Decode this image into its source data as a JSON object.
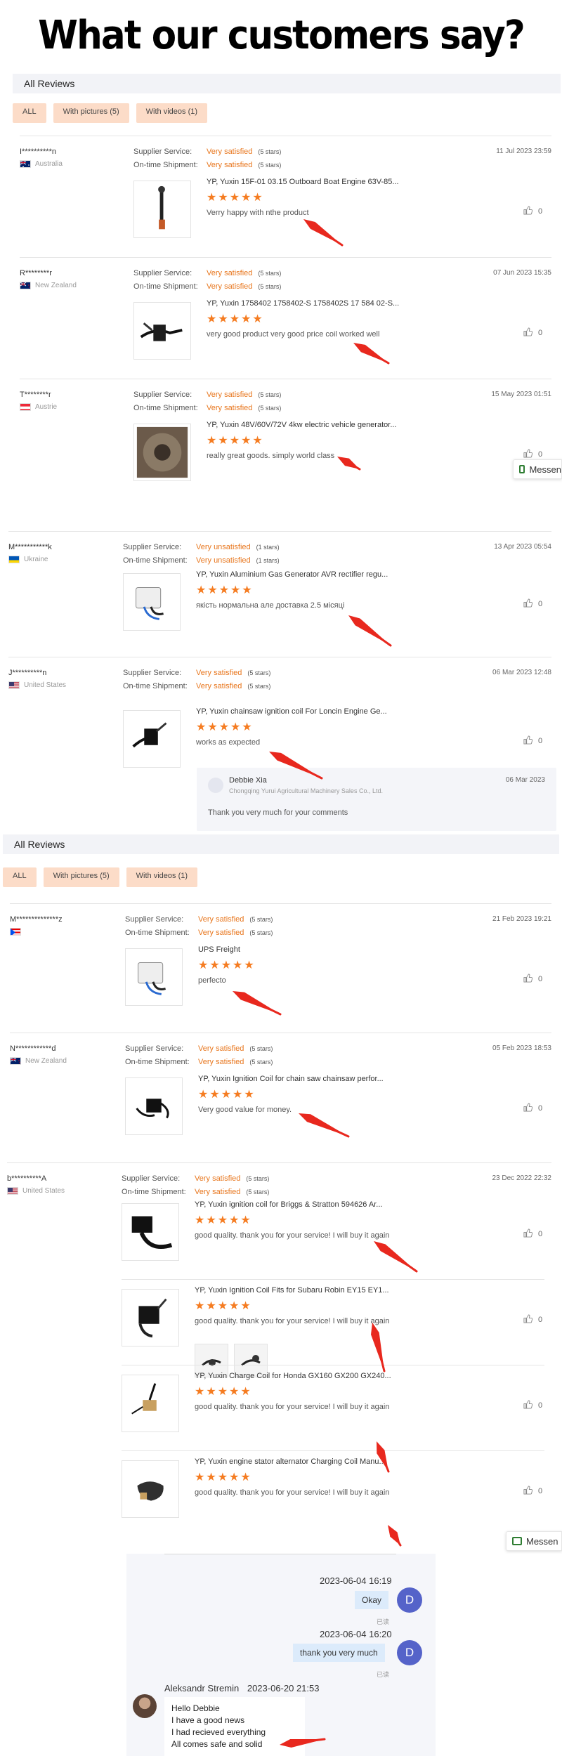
{
  "headline": "What our customers say?",
  "section1": {
    "title": "All Reviews",
    "filters": [
      "ALL",
      "With pictures (5)",
      "With videos (1)"
    ]
  },
  "section2": {
    "title": "All Reviews",
    "filters": [
      "ALL",
      "With pictures (5)",
      "With videos (1)"
    ]
  },
  "labels": {
    "supplier": "Supplier Service:",
    "shipment": "On-time Shipment:"
  },
  "colors": {
    "accent": "#e8761d",
    "star": "#f57c21",
    "filter_bg": "#fcdcc8",
    "arrow": "#e8281e"
  },
  "reviews": [
    {
      "user": "I**********n",
      "country": "Australia",
      "flag": "au",
      "date": "11 Jul 2023 23:59",
      "supplier": "Very satisfied",
      "supplier_count": "(5 stars)",
      "shipment": "Very satisfied",
      "shipment_count": "(5 stars)",
      "products": [
        {
          "title": "YP, Yuxin 15F-01 03.15 Outboard Boat Engine 63V-85...",
          "rating": 5,
          "text": "Verry happy with nthe product",
          "likes": "0"
        }
      ]
    },
    {
      "user": "R********r",
      "country": "New Zealand",
      "flag": "nz",
      "date": "07 Jun 2023 15:35",
      "supplier": "Very satisfied",
      "supplier_count": "(5 stars)",
      "shipment": "Very satisfied",
      "shipment_count": "(5 stars)",
      "products": [
        {
          "title": "YP, Yuxin 1758402 1758402-S 1758402S 17 584 02-S...",
          "rating": 5,
          "text": "very good product very good price coil worked well",
          "likes": "0"
        }
      ]
    },
    {
      "user": "T********r",
      "country": "Austrie",
      "flag": "at",
      "date": "15 May 2023 01:51",
      "supplier": "Very satisfied",
      "supplier_count": "(5 stars)",
      "shipment": "Very satisfied",
      "shipment_count": "(5 stars)",
      "products": [
        {
          "title": "YP, Yuxin 48V/60V/72V 4kw electric vehicle generator...",
          "rating": 5,
          "text": "really great goods. simply world class",
          "likes": "0"
        }
      ]
    },
    {
      "user": "M***********k",
      "country": "Ukraine",
      "flag": "ua",
      "date": "13 Apr 2023 05:54",
      "supplier": "Very unsatisfied",
      "supplier_count": "(1 stars)",
      "shipment": "Very unsatisfied",
      "shipment_count": "(1 stars)",
      "products": [
        {
          "title": "YP, Yuxin Aluminium Gas Generator AVR rectifier regu...",
          "rating": 5,
          "text": "якість нормальна але доставка 2.5 місяці",
          "likes": "0"
        }
      ]
    },
    {
      "user": "J**********n",
      "country": "United States",
      "flag": "us",
      "date": "06 Mar 2023 12:48",
      "supplier": "Very satisfied",
      "supplier_count": "(5 stars)",
      "shipment": "Very satisfied",
      "shipment_count": "(5 stars)",
      "products": [
        {
          "title": "YP, Yuxin chainsaw ignition coil For Loncin Engine Ge...",
          "rating": 5,
          "text": "works as expected",
          "likes": "0"
        }
      ],
      "reply": {
        "name": "Debbie Xia",
        "company": "Chongqing Yurui Agricultural Machinery Sales Co., Ltd.",
        "date": "06 Mar 2023",
        "text": "Thank you very much for your comments"
      }
    },
    {
      "user": "M**************z",
      "country": "",
      "flag": "pr",
      "date": "21 Feb 2023 19:21",
      "supplier": "Very satisfied",
      "supplier_count": "(5 stars)",
      "shipment": "Very satisfied",
      "shipment_count": "(5 stars)",
      "products": [
        {
          "title": "UPS Freight",
          "rating": 5,
          "text": "perfecto",
          "likes": "0"
        }
      ]
    },
    {
      "user": "N************d",
      "country": "New Zealand",
      "flag": "nz",
      "date": "05 Feb 2023 18:53",
      "supplier": "Very satisfied",
      "supplier_count": "(5 stars)",
      "shipment": "Very satisfied",
      "shipment_count": "(5 stars)",
      "products": [
        {
          "title": "YP, Yuxin Ignition Coil for chain saw chainsaw perfor...",
          "rating": 5,
          "text": "Very good value for money.",
          "likes": "0"
        }
      ]
    },
    {
      "user": "b**********A",
      "country": "United States",
      "flag": "us",
      "date": "23 Dec 2022 22:32",
      "supplier": "Very satisfied",
      "supplier_count": "(5 stars)",
      "shipment": "Very satisfied",
      "shipment_count": "(5 stars)",
      "products": [
        {
          "title": "YP, Yuxin ignition coil for Briggs & Stratton 594626 Ar...",
          "rating": 5,
          "text": "good quality. thank you for your service! I will buy it again",
          "likes": "0"
        },
        {
          "title": "YP, Yuxin Ignition Coil Fits for Subaru Robin EY15 EY1...",
          "rating": 5,
          "text": "good quality. thank you for your service! I will buy it again",
          "likes": "0"
        },
        {
          "title": "YP, Yuxin Charge Coil for Honda GX160 GX200 GX240...",
          "rating": 5,
          "text": "good quality. thank you for your service! I will buy it again",
          "likes": "0"
        },
        {
          "title": "YP, Yuxin engine stator alternator Charging Coil Manu...",
          "rating": 5,
          "text": "good quality. thank you for your service! I will buy it again",
          "likes": "0"
        }
      ]
    }
  ],
  "messenger": {
    "label1": "Messen",
    "label2": "Messen"
  },
  "chat": {
    "messages": [
      {
        "time": "2023-06-04 16:19",
        "text": "Okay",
        "avatar": "D",
        "status": "已读"
      },
      {
        "time": "2023-06-04 16:20",
        "text": "thank you very much",
        "avatar": "D",
        "status": "已读"
      }
    ],
    "incoming": {
      "sender": "Aleksandr Stremin",
      "time": "2023-06-20 21:53",
      "lines": [
        "Hello Debbie",
        "I have a good news",
        "I had recieved everything",
        "All comes safe and solid"
      ]
    }
  }
}
